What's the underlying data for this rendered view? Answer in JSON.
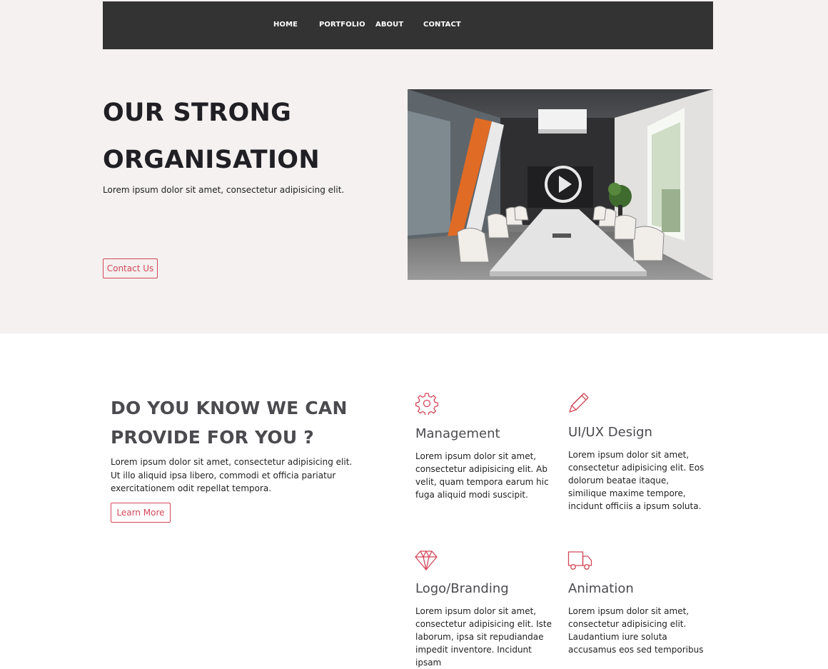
{
  "nav": {
    "items": [
      {
        "label": "HOME"
      },
      {
        "label": "PORTFOLIO"
      },
      {
        "label": "ABOUT"
      },
      {
        "label": "CONTACT"
      }
    ]
  },
  "hero": {
    "title_line1": "OUR STRONG",
    "title_line2": "ORGANISATION",
    "subtitle": "Lorem ipsum dolor sit amet, consectetur adipisicing elit.",
    "button_label": "Contact Us",
    "video_play_icon": "play-icon"
  },
  "services": {
    "title_line1": "DO YOU KNOW WE CAN",
    "title_line2": "PROVIDE FOR YOU ?",
    "description": "Lorem ipsum dolor sit amet, consectetur adipisicing elit. Ut illo aliquid ipsa libero, commodi et officia pariatur exercitationem odit repellat tempora.",
    "button_label": "Learn More",
    "cards": [
      {
        "icon": "gear-icon",
        "title": "Management",
        "text": "Lorem ipsum dolor sit amet, consectetur adipisicing elit. Ab velit, quam tempora earum hic fuga aliquid modi suscipit."
      },
      {
        "icon": "pencil-icon",
        "title": "UI/UX Design",
        "text": "Lorem ipsum dolor sit amet, consectetur adipisicing elit. Eos dolorum beatae itaque, similique maxime tempore, incidunt officiis a ipsum soluta."
      },
      {
        "icon": "diamond-icon",
        "title": "Logo/Branding",
        "text": "Lorem ipsum dolor sit amet, consectetur adipisicing elit. Iste laborum, ipsa sit repudiandae impedit inventore. Incidunt ipsam"
      },
      {
        "icon": "truck-icon",
        "title": "Animation",
        "text": "Lorem ipsum dolor sit amet, consectetur adipisicing elit. Laudantium iure soluta accusamus eos sed temporibus"
      }
    ]
  },
  "colors": {
    "accent": "#d3475a",
    "nav_bg": "#333333",
    "hero_bg": "#f4f1f0",
    "heading": "#1f1f24",
    "sub_heading": "#4a4a4f"
  }
}
